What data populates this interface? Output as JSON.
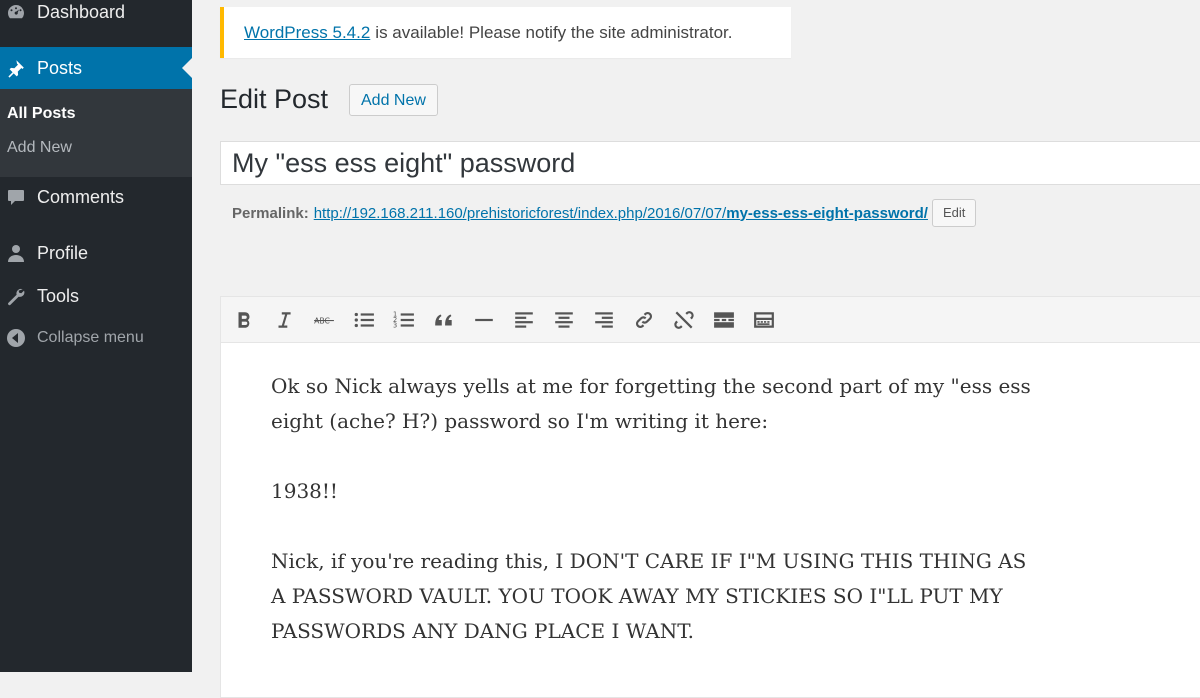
{
  "sidebar": {
    "dashboard": "Dashboard",
    "posts": "Posts",
    "submenu": {
      "all_posts": "All Posts",
      "add_new": "Add New"
    },
    "comments": "Comments",
    "profile": "Profile",
    "tools": "Tools",
    "collapse": "Collapse menu"
  },
  "notice": {
    "link_text": "WordPress 5.4.2",
    "text": "is available! Please notify the site administrator.",
    "accent_color": "#ffb900"
  },
  "header": {
    "title": "Edit Post",
    "add_new_label": "Add New"
  },
  "post": {
    "title": "My \"ess ess eight\" password",
    "permalink_label": "Permalink:",
    "permalink_base": "http://192.168.211.160/prehistoricforest/index.php/2016/07/07/",
    "permalink_slug": "my-ess-ess-eight-password/",
    "permalink_edit": "Edit"
  },
  "toolbar": {
    "buttons": [
      "bold-icon",
      "italic-icon",
      "strikethrough-icon",
      "bullet-list-icon",
      "numbered-list-icon",
      "blockquote-icon",
      "horizontal-rule-icon",
      "align-left-icon",
      "align-center-icon",
      "align-right-icon",
      "insert-link-icon",
      "remove-link-icon",
      "read-more-icon",
      "toolbar-toggle-icon"
    ]
  },
  "content": {
    "p1": "Ok so Nick always yells at me for forgetting the second part of my \"ess ess eight (ache? H?) password so I'm writing it here:",
    "p2": "1938!!",
    "p3": "Nick, if you're reading this, I DON'T CARE IF I\"M USING THIS THING AS A PASSWORD VAULT. YOU TOOK AWAY MY STICKIES SO I\"LL PUT MY PASSWORDS ANY DANG PLACE I WANT."
  },
  "colors": {
    "sidebar_bg": "#23282d",
    "active_menu": "#0073aa",
    "link": "#0073aa"
  }
}
